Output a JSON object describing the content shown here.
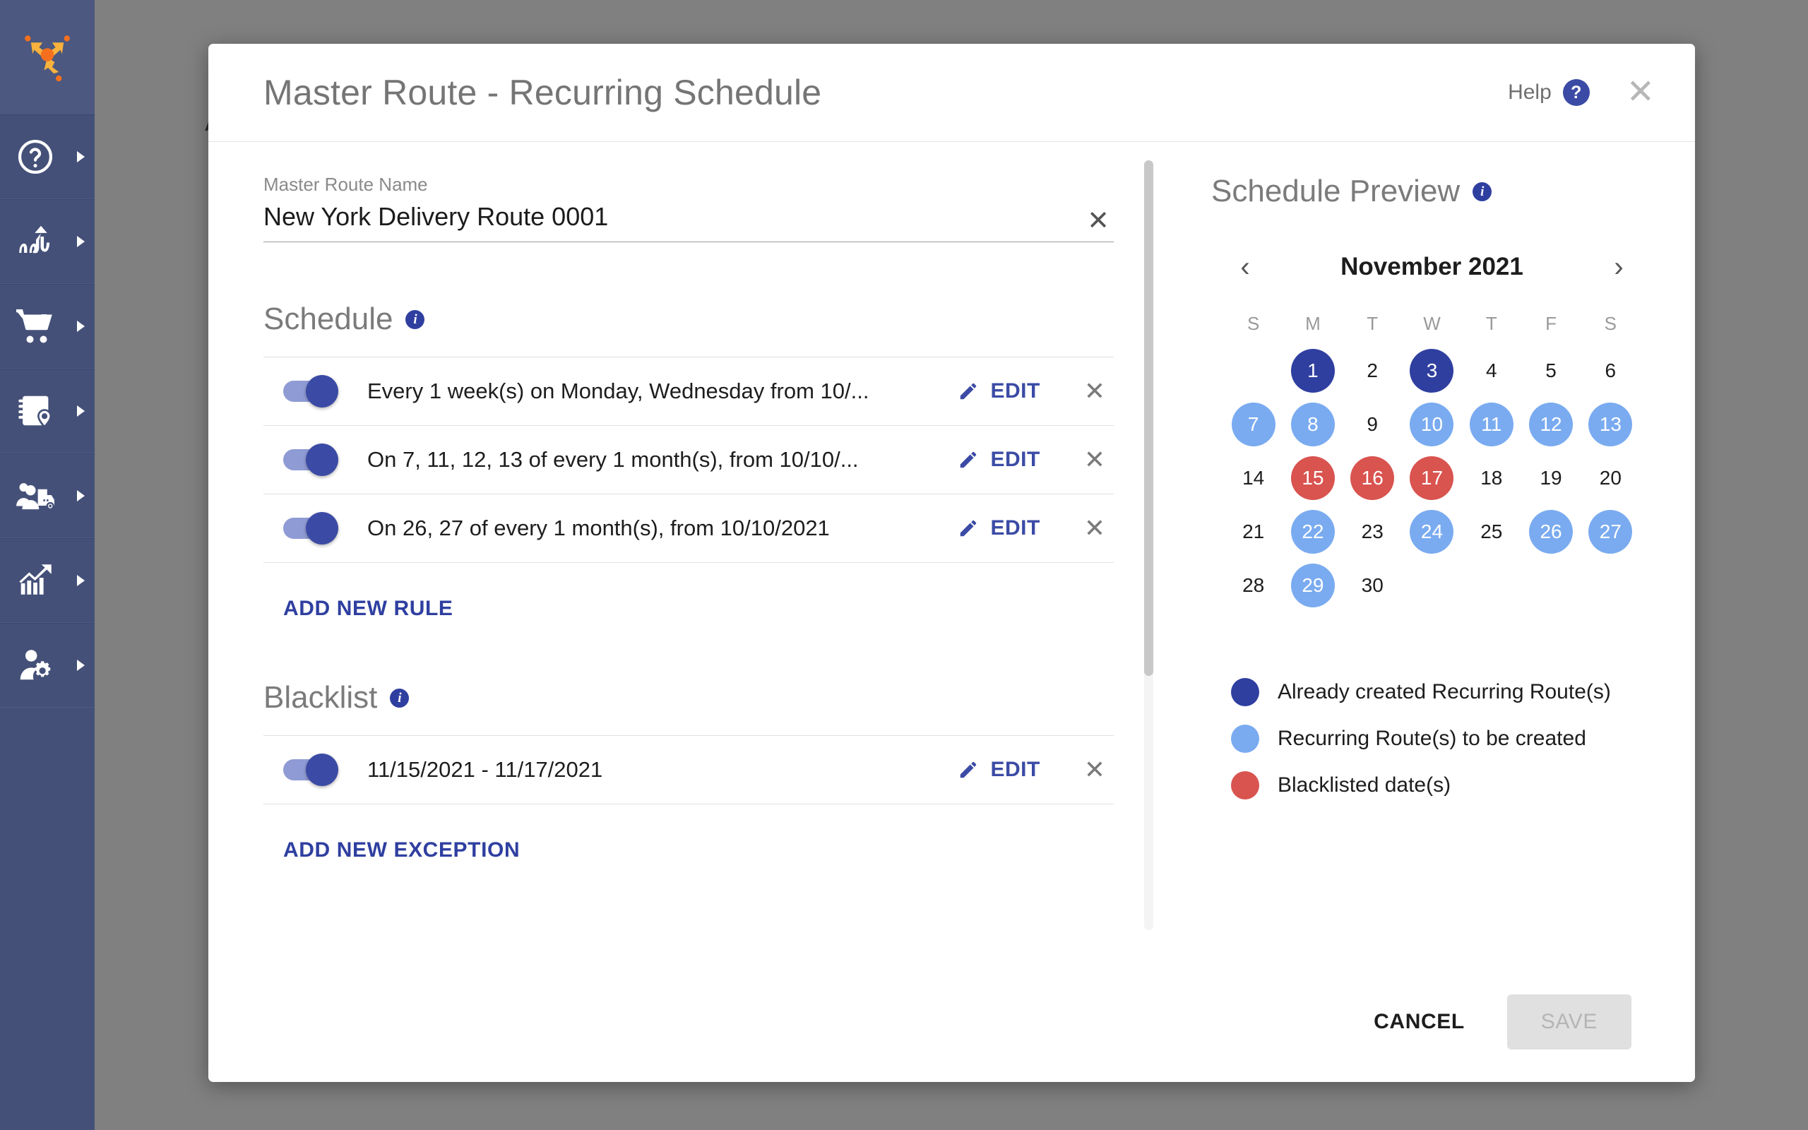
{
  "sidebar": {
    "logo_name": "routing-logo",
    "items": [
      {
        "icon": "help-circle-icon",
        "name": "sidebar-item-help"
      },
      {
        "icon": "route-optimize-icon",
        "name": "sidebar-item-routing"
      },
      {
        "icon": "shopping-cart-icon",
        "name": "sidebar-item-orders"
      },
      {
        "icon": "address-book-location-icon",
        "name": "sidebar-item-addressbook"
      },
      {
        "icon": "fleet-people-truck-icon",
        "name": "sidebar-item-fleet"
      },
      {
        "icon": "analytics-chart-icon",
        "name": "sidebar-item-analytics"
      },
      {
        "icon": "user-settings-icon",
        "name": "sidebar-item-account"
      }
    ]
  },
  "background": {
    "partial_text": "A"
  },
  "header": {
    "title": "Master Route - Recurring Schedule",
    "help_label": "Help",
    "help_icon_glyph": "?",
    "close_glyph": "✕"
  },
  "route_name": {
    "label": "Master Route Name",
    "value": "New York Delivery Route 0001",
    "clear_glyph": "✕"
  },
  "schedule": {
    "title": "Schedule",
    "info_glyph": "i",
    "rules": [
      {
        "enabled": true,
        "text": "Every 1 week(s) on Monday, Wednesday from 10/..."
      },
      {
        "enabled": true,
        "text": "On 7, 11, 12, 13 of every 1 month(s), from 10/10/..."
      },
      {
        "enabled": true,
        "text": "On 26, 27 of every 1 month(s), from 10/10/2021"
      }
    ],
    "edit_label": "EDIT",
    "remove_glyph": "✕",
    "add_label": "ADD NEW RULE"
  },
  "blacklist": {
    "title": "Blacklist",
    "info_glyph": "i",
    "rules": [
      {
        "enabled": true,
        "text": "11/15/2021 - 11/17/2021"
      }
    ],
    "edit_label": "EDIT",
    "remove_glyph": "✕",
    "add_label": "ADD NEW EXCEPTION"
  },
  "preview": {
    "title": "Schedule Preview",
    "info_glyph": "i",
    "prev_glyph": "‹",
    "next_glyph": "›",
    "month_label": "November 2021",
    "day_headers": [
      "S",
      "M",
      "T",
      "W",
      "T",
      "F",
      "S"
    ],
    "leading_blanks": 1,
    "days": [
      {
        "n": 1,
        "state": "created"
      },
      {
        "n": 2,
        "state": "none"
      },
      {
        "n": 3,
        "state": "created"
      },
      {
        "n": 4,
        "state": "none"
      },
      {
        "n": 5,
        "state": "none"
      },
      {
        "n": 6,
        "state": "none"
      },
      {
        "n": 7,
        "state": "tobe"
      },
      {
        "n": 8,
        "state": "tobe"
      },
      {
        "n": 9,
        "state": "none"
      },
      {
        "n": 10,
        "state": "tobe"
      },
      {
        "n": 11,
        "state": "tobe"
      },
      {
        "n": 12,
        "state": "tobe"
      },
      {
        "n": 13,
        "state": "tobe"
      },
      {
        "n": 14,
        "state": "none"
      },
      {
        "n": 15,
        "state": "black"
      },
      {
        "n": 16,
        "state": "black"
      },
      {
        "n": 17,
        "state": "black"
      },
      {
        "n": 18,
        "state": "none"
      },
      {
        "n": 19,
        "state": "none"
      },
      {
        "n": 20,
        "state": "none"
      },
      {
        "n": 21,
        "state": "none"
      },
      {
        "n": 22,
        "state": "tobe"
      },
      {
        "n": 23,
        "state": "none"
      },
      {
        "n": 24,
        "state": "tobe"
      },
      {
        "n": 25,
        "state": "none"
      },
      {
        "n": 26,
        "state": "tobe"
      },
      {
        "n": 27,
        "state": "tobe"
      },
      {
        "n": 28,
        "state": "none"
      },
      {
        "n": 29,
        "state": "tobe"
      },
      {
        "n": 30,
        "state": "none"
      }
    ],
    "legend": [
      {
        "color": "#2f3fa0",
        "label": "Already created Recurring Route(s)"
      },
      {
        "color": "#7aabf0",
        "label": "Recurring Route(s) to be created"
      },
      {
        "color": "#d9534f",
        "label": "Blacklisted date(s)"
      }
    ]
  },
  "footer": {
    "cancel_label": "CANCEL",
    "save_label": "SAVE",
    "save_disabled": true
  },
  "colors": {
    "brand_navy": "#445078",
    "accent_blue": "#3b4ba5",
    "created_navy": "#2f3fa0",
    "tobe_blue": "#7aabf0",
    "blacklist_red": "#d9534f",
    "logo_orange": "#f4701f",
    "logo_yellow": "#f9b23d",
    "backdrop_gray": "#808080"
  }
}
